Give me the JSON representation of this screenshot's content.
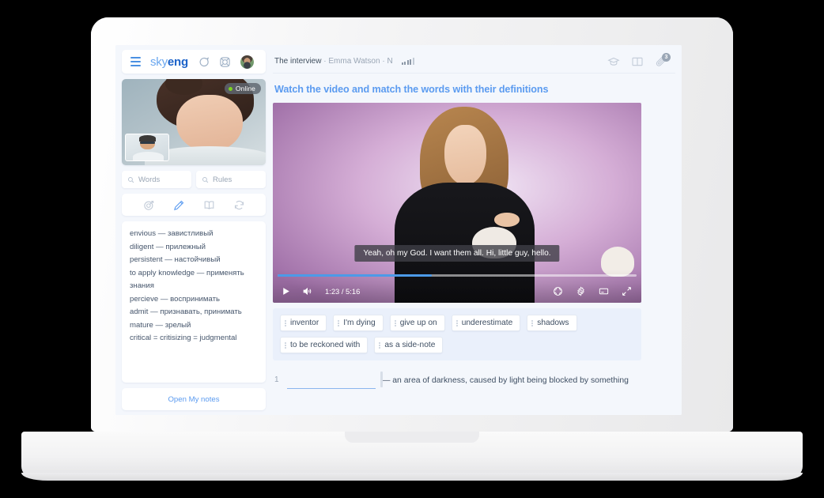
{
  "brand": {
    "logo_sky": "sky",
    "logo_eng": "eng",
    "menu_icon": "hamburger-icon",
    "chat_icon": "chat-bubble-icon",
    "support_icon": "lifebuoy-icon",
    "avatar": "user-avatar"
  },
  "webcam": {
    "status_label": "Online",
    "status_color": "#7ed321"
  },
  "search": {
    "words_placeholder": "Words",
    "rules_placeholder": "Rules"
  },
  "tools": [
    {
      "name": "target-icon",
      "active": false
    },
    {
      "name": "pencil-icon",
      "active": true
    },
    {
      "name": "book-icon",
      "active": false
    },
    {
      "name": "refresh-icon",
      "active": false
    }
  ],
  "notes": {
    "items": [
      "envious — завистливый",
      "diligent — прилежный",
      "persistent — настойчивый",
      "to apply knowledge — применять знания",
      "percieve — воспринимать",
      "admit — признавать, принимать",
      "mature — зрелый",
      "critical = critisizing = judgmental"
    ],
    "footer_link": "Open My notes"
  },
  "topbar": {
    "crumb_title": "The interview",
    "crumb_sep1": " · ",
    "crumb_author": "Emma Watson",
    "crumb_sep2": " · ",
    "crumb_level": "N",
    "signal_icon": "signal-bars-icon",
    "icons": [
      {
        "name": "graduation-cap-icon",
        "badge": ""
      },
      {
        "name": "open-book-icon",
        "badge": ""
      },
      {
        "name": "paperclip-icon",
        "badge": "3"
      }
    ]
  },
  "lesson": {
    "title": "Watch the video and match the words with their definitions"
  },
  "video": {
    "subtitle": "Yeah, oh my God. I want them all. Hi, little guy, hello.",
    "current_time": "1:23",
    "duration": "5:16",
    "time_label": "1:23 / 5:16",
    "progress_percent": 43,
    "progress_color": "#4c9ae8",
    "play_icon": "play-icon",
    "volume_icon": "volume-icon",
    "right_icons": [
      {
        "name": "focus-frame-icon"
      },
      {
        "name": "settings-gear-icon"
      },
      {
        "name": "captions-icon"
      },
      {
        "name": "fullscreen-icon"
      }
    ]
  },
  "chips": [
    "inventor",
    "I'm dying",
    "give up on",
    "underestimate",
    "shadows",
    "to be reckoned with",
    "as a side-note"
  ],
  "exercise": {
    "items": [
      {
        "number": "1",
        "answer": "",
        "definition": "— an area of darkness, caused by light being blocked by something"
      }
    ]
  }
}
